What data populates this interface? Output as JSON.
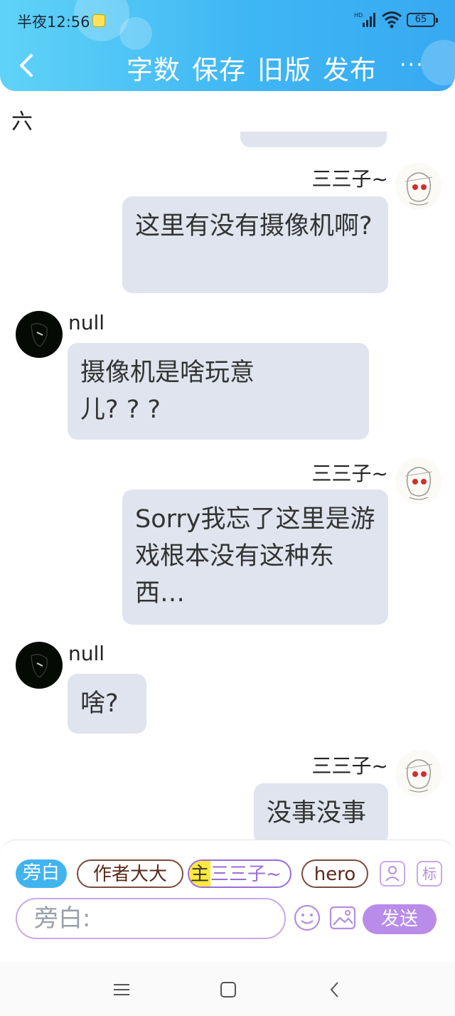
{
  "status_bar": {
    "time": "半夜12:56",
    "battery": "65",
    "network": "HD"
  },
  "nav": {
    "word_count": "字数",
    "save": "保存",
    "old_version": "旧版",
    "publish": "发布",
    "more": "···"
  },
  "chapter_label": "六",
  "messages": [
    {
      "speaker": "三三子~",
      "side": "right",
      "text": "这里有没有摄像机啊?"
    },
    {
      "speaker": "null",
      "side": "left",
      "text": "摄像机是啥玩意儿? ? ?"
    },
    {
      "speaker": "三三子~",
      "side": "right",
      "text": "Sorry我忘了这里是游戏根本没有这种东西…"
    },
    {
      "speaker": "null",
      "side": "left",
      "text": "啥?"
    },
    {
      "speaker": "三三子~",
      "side": "right",
      "text": "没事没事"
    }
  ],
  "role_chips": {
    "narrator": "旁白",
    "author": "作者大大",
    "main_tag": "主",
    "main_name": "三三子~",
    "hero": "hero",
    "mark_button": "标"
  },
  "input": {
    "placeholder": "旁白:",
    "send": "发送"
  },
  "colors": {
    "header_start": "#5fd3f7",
    "header_end": "#37a9f2",
    "bubble": "#dfe4ee",
    "accent_purple": "#b98cea"
  }
}
